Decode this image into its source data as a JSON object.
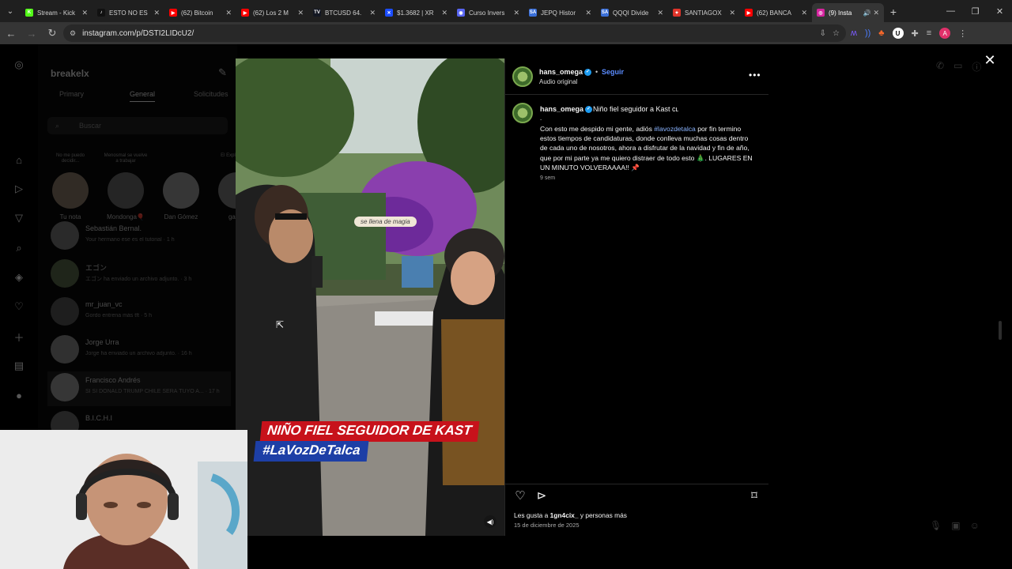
{
  "browser": {
    "tabs": [
      {
        "title": "Stream - Kick",
        "favicon_color": "#53fc18",
        "favicon_letter": "K"
      },
      {
        "title": "ESTO NO ES",
        "favicon_color": "#111111",
        "favicon_letter": "♪"
      },
      {
        "title": "(62) Bitcoin",
        "favicon_color": "#ff0000",
        "favicon_letter": "▶"
      },
      {
        "title": "(62) Los 2 M",
        "favicon_color": "#ff0000",
        "favicon_letter": "▶"
      },
      {
        "title": "BTCUSD 64.",
        "favicon_color": "#131722",
        "favicon_letter": "TV"
      },
      {
        "title": "$1.3682 | XR",
        "favicon_color": "#1b4dff",
        "favicon_letter": "✕"
      },
      {
        "title": "Curso Invers",
        "favicon_color": "#5865f2",
        "favicon_letter": "◉"
      },
      {
        "title": "JEPQ Histor",
        "favicon_color": "#3a6fd8",
        "favicon_letter": "SA"
      },
      {
        "title": "QQQI Divide",
        "favicon_color": "#3a6fd8",
        "favicon_letter": "SA"
      },
      {
        "title": "SANTIAGOX",
        "favicon_color": "#e0342a",
        "favicon_letter": "✦"
      },
      {
        "title": "(62) BANCA",
        "favicon_color": "#ff0000",
        "favicon_letter": "▶"
      },
      {
        "title": "(9) Insta",
        "favicon_color": "#d6249f",
        "favicon_letter": "◎"
      }
    ],
    "url": "instagram.com/p/DSTI2LIDcU2/"
  },
  "dm": {
    "username": "breakelx",
    "tabs": {
      "primary": "Primary",
      "general": "General",
      "requests": "Solicitudes"
    },
    "search_placeholder": "Buscar",
    "stories": [
      {
        "note": "No me puedo decidir...",
        "name": "Tu nota",
        "color": "#8a7a6a"
      },
      {
        "note": "Menosmal se vuelve a trabajar",
        "name": "Mondonga🎈",
        "color": "#6a6a6a"
      },
      {
        "note": "",
        "name": "Dan Gómez",
        "color": "#9a9a9a"
      },
      {
        "note": "El Explic Show",
        "name": "gamb",
        "color": "#7a7a7a"
      }
    ],
    "conversations": [
      {
        "name": "Sebastián Bernal.",
        "preview": "Your hermano ese es el tutorial · 1 h",
        "color": "#777"
      },
      {
        "name": "エゴン",
        "preview": "エゴン ha enviado un archivo adjunto. · 3 h",
        "color": "#5a6a4a"
      },
      {
        "name": "mr_juan_vc",
        "preview": "Gordo entrena más tft · 5 h",
        "color": "#555"
      },
      {
        "name": "Jorge Urra",
        "preview": "Jorge ha enviado un archivo adjunto. · 16 h",
        "color": "#888"
      },
      {
        "name": "Francisco Andrés",
        "preview": "SI SI DONALD TRUMP CHILE SERÁ TUYO A... · 17 h",
        "color": "#999"
      },
      {
        "name": "B.I.C.H.I",
        "preview": "",
        "color": "#666"
      }
    ]
  },
  "post": {
    "author": "hans_omega",
    "follow_label": "Seguir",
    "separator": "•",
    "audio": "Audio original",
    "caption_title": "Niño fiel seguidor a Kast cʟ",
    "caption_dot": ".",
    "caption_pre": "Con esto me despido mi gente, adiós ",
    "caption_tag": "#lavozdetalca",
    "caption_post": " por fin termino estos tiempos de candidaturas, donde conlleva muchas cosas dentro de cada uno de nosotros, ahora a disfrutar de la navidad y fin de año, que por mi parte ya me quiero distraer de todo esto 🎄. LUGARES EN UN MINUTO VOLVERAAAA!! 📌",
    "time_ago": "9 sem",
    "likes_prefix": "Les gusta a ",
    "likes_user": "1gn4cix_",
    "likes_suffix": " y personas más",
    "date": "15 de diciembre de 2025",
    "video_caption_line1": "NIÑO FIEL SEGUIDOR DE KAST",
    "video_caption_line2": "#LaVozDeTalca",
    "video_sign": "se llena de magia"
  }
}
